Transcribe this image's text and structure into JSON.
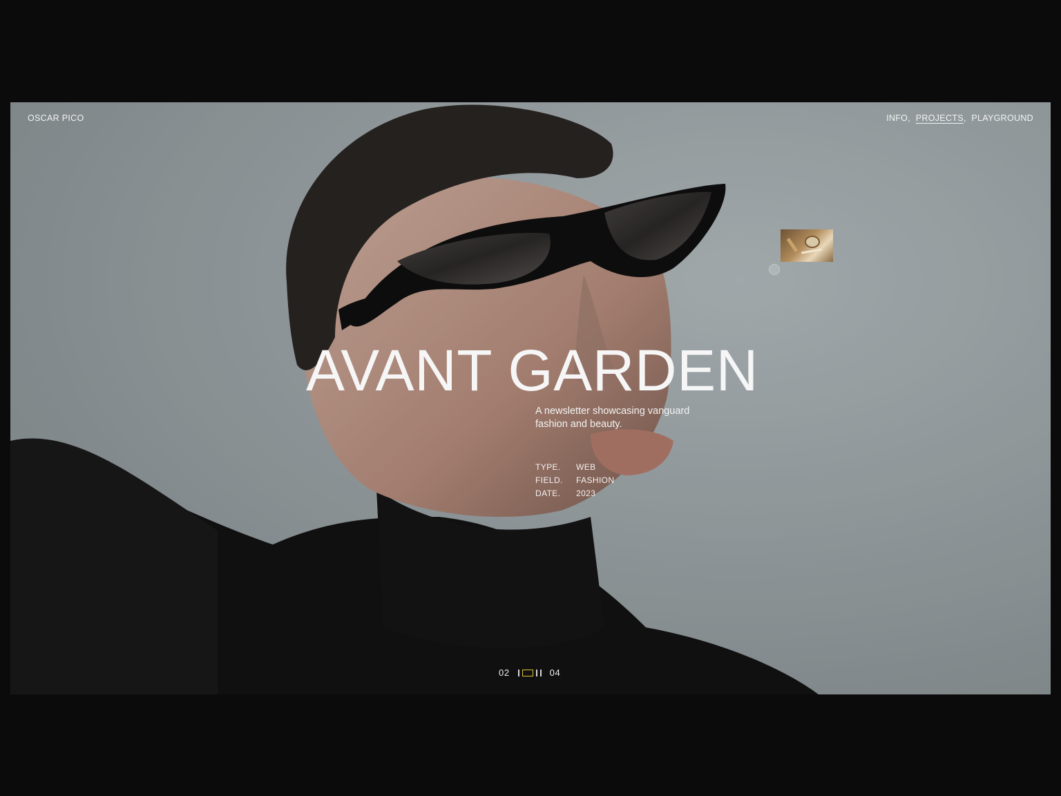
{
  "header": {
    "brand": "OSCAR PICO",
    "nav": [
      {
        "label": "INFO",
        "sep": ",",
        "active": false
      },
      {
        "label": "PROJECTS",
        "sep": ",",
        "active": true
      },
      {
        "label": "PLAYGROUND",
        "sep": "",
        "active": false
      }
    ]
  },
  "project": {
    "title": "AVANT GARDEN",
    "description": "A newsletter showcasing vanguard fashion and beauty.",
    "meta": [
      {
        "key": "TYPE.",
        "value": "WEB"
      },
      {
        "key": "FIELD.",
        "value": "FASHION"
      },
      {
        "key": "DATE.",
        "value": "2023"
      }
    ]
  },
  "pager": {
    "current": "02",
    "total": "04"
  },
  "colors": {
    "background": "#0b0b0c",
    "text": "#f3f3f3",
    "pager_accent": "#e0c23b"
  }
}
